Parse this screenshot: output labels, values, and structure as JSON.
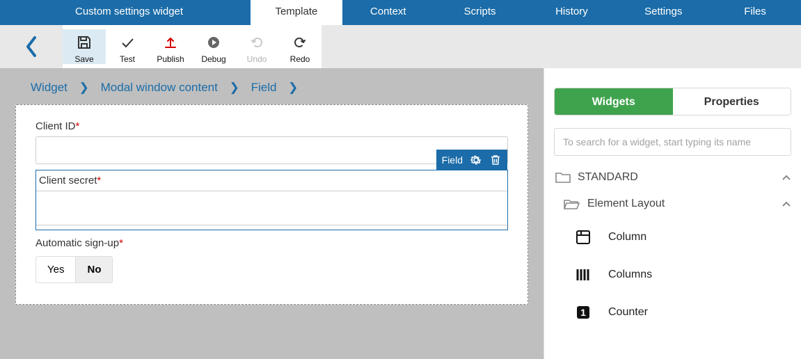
{
  "header": {
    "title": "Custom settings widget",
    "tabs": [
      "Template",
      "Context",
      "Scripts",
      "History",
      "Settings",
      "Files"
    ],
    "active_tab": "Template"
  },
  "toolbar": {
    "save": "Save",
    "test": "Test",
    "publish": "Publish",
    "debug": "Debug",
    "undo": "Undo",
    "redo": "Redo"
  },
  "breadcrumb": [
    "Widget",
    "Modal window content",
    "Field"
  ],
  "form": {
    "client_id_label": "Client ID",
    "client_secret_label": "Client secret",
    "auto_signup_label": "Automatic sign-up",
    "yes": "Yes",
    "no": "No",
    "selected_tag": "Field"
  },
  "sidebar": {
    "seg_widgets": "Widgets",
    "seg_properties": "Properties",
    "search_placeholder": "To search for a widget, start typing its name",
    "group_standard": "STANDARD",
    "group_layout": "Element Layout",
    "widgets": [
      {
        "label": "Column"
      },
      {
        "label": "Columns"
      },
      {
        "label": "Counter"
      }
    ]
  }
}
